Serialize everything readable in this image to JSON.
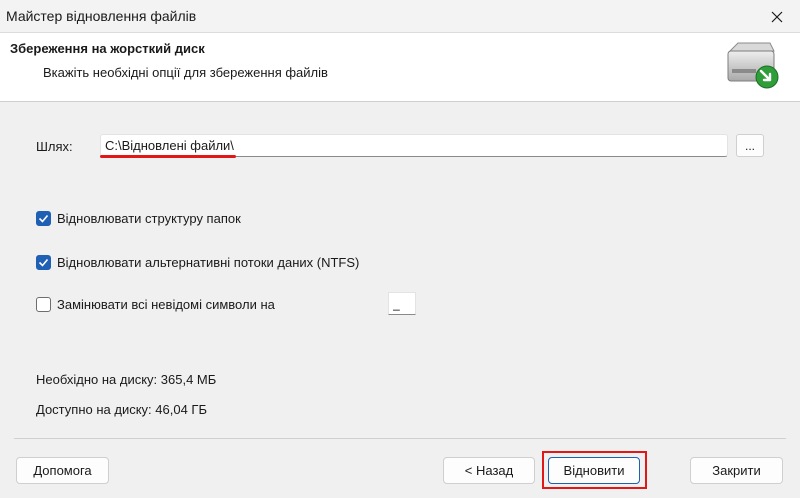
{
  "window": {
    "title": "Майстер відновлення файлів"
  },
  "header": {
    "title": "Збереження на жорсткий диск",
    "subtitle": "Вкажіть необхідні опції для збереження файлів",
    "icon": "hard-drive-save-icon"
  },
  "path": {
    "label": "Шлях:",
    "value": "C:\\Відновлені файли\\",
    "browse_label": "..."
  },
  "options": {
    "restore_structure": {
      "label": "Відновлювати структуру папок",
      "checked": true
    },
    "restore_streams": {
      "label": "Відновлювати альтернативні потоки даних (NTFS)",
      "checked": true
    },
    "replace_unknown": {
      "label": "Замінювати всі невідомі символи на",
      "checked": false,
      "value": "_"
    }
  },
  "disk": {
    "required": "Необхідно на диску: 365,4 МБ",
    "available": "Доступно на диску: 46,04 ГБ"
  },
  "buttons": {
    "help": "Допомога",
    "back": "< Назад",
    "recover": "Відновити",
    "close": "Закрити"
  },
  "colors": {
    "accent": "#1f5fb4",
    "highlight": "#e01818"
  }
}
